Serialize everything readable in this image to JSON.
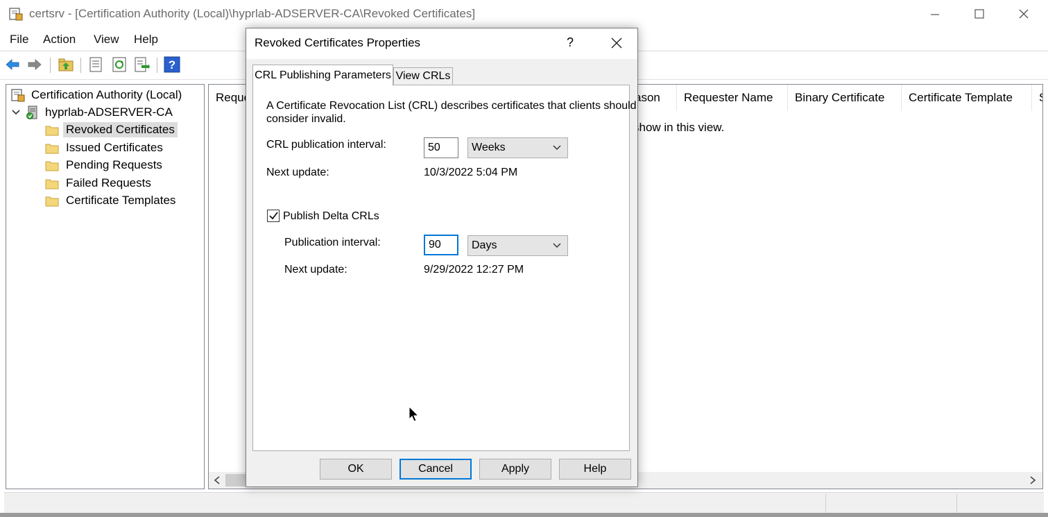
{
  "window": {
    "title": "certsrv - [Certification Authority (Local)\\hyprlab-ADSERVER-CA\\Revoked Certificates]"
  },
  "menu": {
    "items": [
      "File",
      "Action",
      "View",
      "Help"
    ]
  },
  "toolbar": {
    "icons": [
      "back-icon",
      "forward-icon",
      "up-folder-icon",
      "properties-icon",
      "refresh-icon",
      "export-list-icon",
      "help-icon"
    ]
  },
  "tree": {
    "root": "Certification Authority (Local)",
    "ca": "hyprlab-ADSERVER-CA",
    "folders": [
      "Revoked Certificates",
      "Issued Certificates",
      "Pending Requests",
      "Failed Requests",
      "Certificate Templates"
    ],
    "selected_index": 0
  },
  "list": {
    "columns": [
      "Reque",
      "ason",
      "Requester Name",
      "Binary Certificate",
      "Certificate Template",
      "S"
    ],
    "empty_message": "show in this view."
  },
  "dialog": {
    "title": "Revoked Certificates Properties",
    "help_label": "?",
    "tabs": [
      "CRL Publishing Parameters",
      "View CRLs"
    ],
    "active_tab": 0,
    "description_line1": "A Certificate Revocation List (CRL) describes certificates that clients should",
    "description_line2": "consider invalid.",
    "crl_interval_label": "CRL publication interval:",
    "crl_interval_value": "50",
    "crl_interval_unit": "Weeks",
    "crl_next_update_label": "Next update:",
    "crl_next_update_value": "10/3/2022 5:04 PM",
    "delta_checkbox_label": "Publish Delta CRLs",
    "delta_checked": true,
    "delta_interval_label": "Publication interval:",
    "delta_interval_value": "90",
    "delta_interval_unit": "Days",
    "delta_next_update_label": "Next update:",
    "delta_next_update_value": "9/29/2022 12:27 PM",
    "buttons": {
      "ok": "OK",
      "cancel": "Cancel",
      "apply": "Apply",
      "help": "Help"
    }
  },
  "colors": {
    "accent": "#0078d7",
    "folder": "#f4d77a",
    "dialog_bg": "#f0f0f0"
  }
}
